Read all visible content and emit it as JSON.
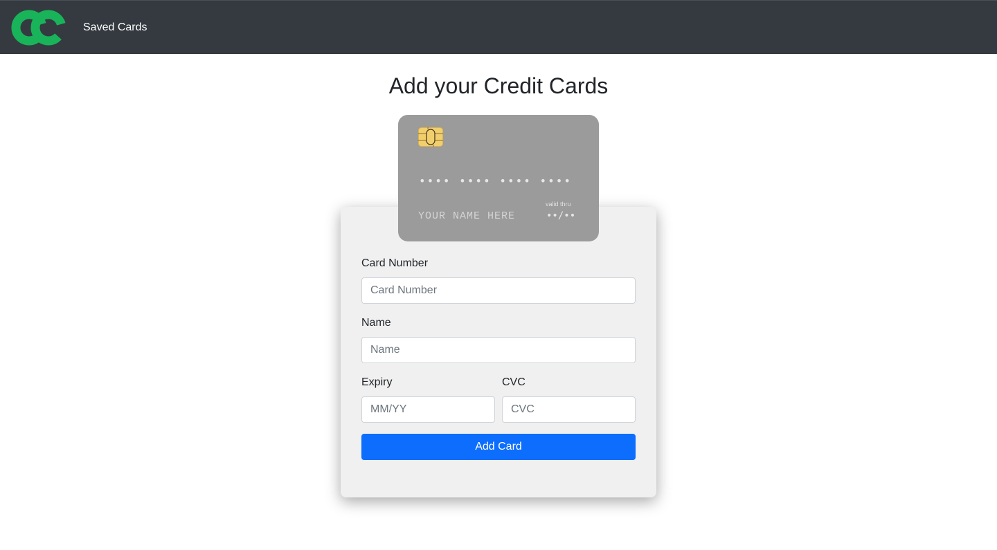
{
  "navbar": {
    "logo_icon": "cc-logo-icon",
    "link_label": "Saved Cards",
    "background": "#343a40"
  },
  "page": {
    "title": "Add your Credit Cards"
  },
  "card_preview": {
    "chip_icon": "card-chip-icon",
    "number": "•••• •••• •••• ••••",
    "name": "YOUR NAME HERE",
    "valid_label": "valid thru",
    "valid_value": "••/••",
    "background": "#9b9b9b"
  },
  "form": {
    "card_number": {
      "label": "Card Number",
      "placeholder": "Card Number",
      "value": ""
    },
    "name": {
      "label": "Name",
      "placeholder": "Name",
      "value": ""
    },
    "expiry": {
      "label": "Expiry",
      "placeholder": "MM/YY",
      "value": ""
    },
    "cvc": {
      "label": "CVC",
      "placeholder": "CVC",
      "value": ""
    },
    "submit_label": "Add Card"
  },
  "colors": {
    "logo_green": "#1db954",
    "primary": "#0d6efd",
    "panel": "#f0f0f0",
    "chip": "#f2cf6d"
  }
}
